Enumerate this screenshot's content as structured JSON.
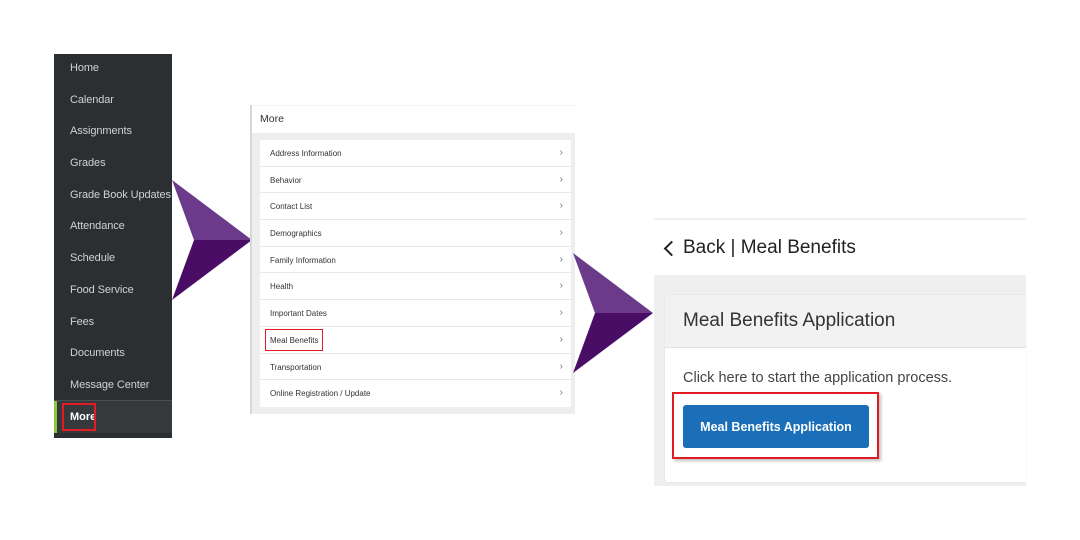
{
  "sidebar": {
    "items": [
      {
        "label": "Home"
      },
      {
        "label": "Calendar"
      },
      {
        "label": "Assignments"
      },
      {
        "label": "Grades"
      },
      {
        "label": "Grade Book Updates"
      },
      {
        "label": "Attendance"
      },
      {
        "label": "Schedule"
      },
      {
        "label": "Food Service"
      },
      {
        "label": "Fees"
      },
      {
        "label": "Documents"
      },
      {
        "label": "Message Center"
      }
    ],
    "active_item": {
      "label": "More"
    },
    "colors": {
      "background": "#2b2f31",
      "accent": "#8dc63f",
      "highlight": "#e31b23"
    }
  },
  "more_panel": {
    "title": "More",
    "items": [
      {
        "label": "Address Information",
        "icon": "chevron-right-icon"
      },
      {
        "label": "Behavior",
        "icon": "chevron-right-icon"
      },
      {
        "label": "Contact List",
        "icon": "chevron-right-icon"
      },
      {
        "label": "Demographics",
        "icon": "chevron-right-icon"
      },
      {
        "label": "Family Information",
        "icon": "chevron-right-icon"
      },
      {
        "label": "Health",
        "icon": "chevron-right-icon"
      },
      {
        "label": "Important Dates",
        "icon": "chevron-right-icon"
      },
      {
        "label": "Meal Benefits",
        "icon": "chevron-right-icon",
        "highlighted": true
      },
      {
        "label": "Transportation",
        "icon": "chevron-right-icon"
      },
      {
        "label": "Online Registration / Update",
        "icon": "chevron-right-icon"
      }
    ],
    "chevron_glyph": "›"
  },
  "meal_panel": {
    "back_label": "Back | Meal Benefits",
    "card_title": "Meal Benefits Application",
    "card_text": "Click here to start the application process.",
    "button_label": "Meal Benefits Application",
    "colors": {
      "button": "#1a6fb8",
      "highlight": "#e31b23"
    }
  },
  "arrows": {
    "icon": "step-arrow-icon",
    "colors": {
      "light": "#6b3a8a",
      "dark": "#4a0d66"
    }
  }
}
